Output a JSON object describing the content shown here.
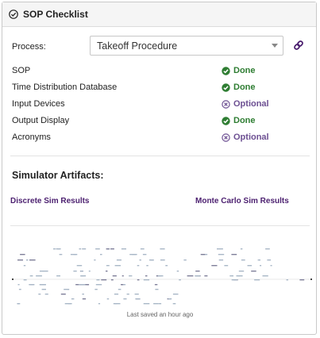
{
  "header": {
    "title": "SOP Checklist",
    "icon": "check-circle-icon"
  },
  "process": {
    "label": "Process:",
    "selected": "Takeoff Procedure",
    "link_icon": "link-icon"
  },
  "checklist": [
    {
      "label": "SOP",
      "status": "Done"
    },
    {
      "label": "Time Distribution Database",
      "status": "Done"
    },
    {
      "label": "Input Devices",
      "status": "Optional"
    },
    {
      "label": "Output Display",
      "status": "Done"
    },
    {
      "label": "Acronyms",
      "status": "Optional"
    }
  ],
  "colors": {
    "done": "#2e7d32",
    "optional": "#6c4f92",
    "link": "#4b1f6f"
  },
  "artifacts": {
    "title": "Simulator Artifacts:",
    "discrete_label": "Discrete Sim Results",
    "monte_carlo_label": "Monte Carlo Sim Results"
  },
  "footer": {
    "saved": "Last saved an hour ago"
  }
}
